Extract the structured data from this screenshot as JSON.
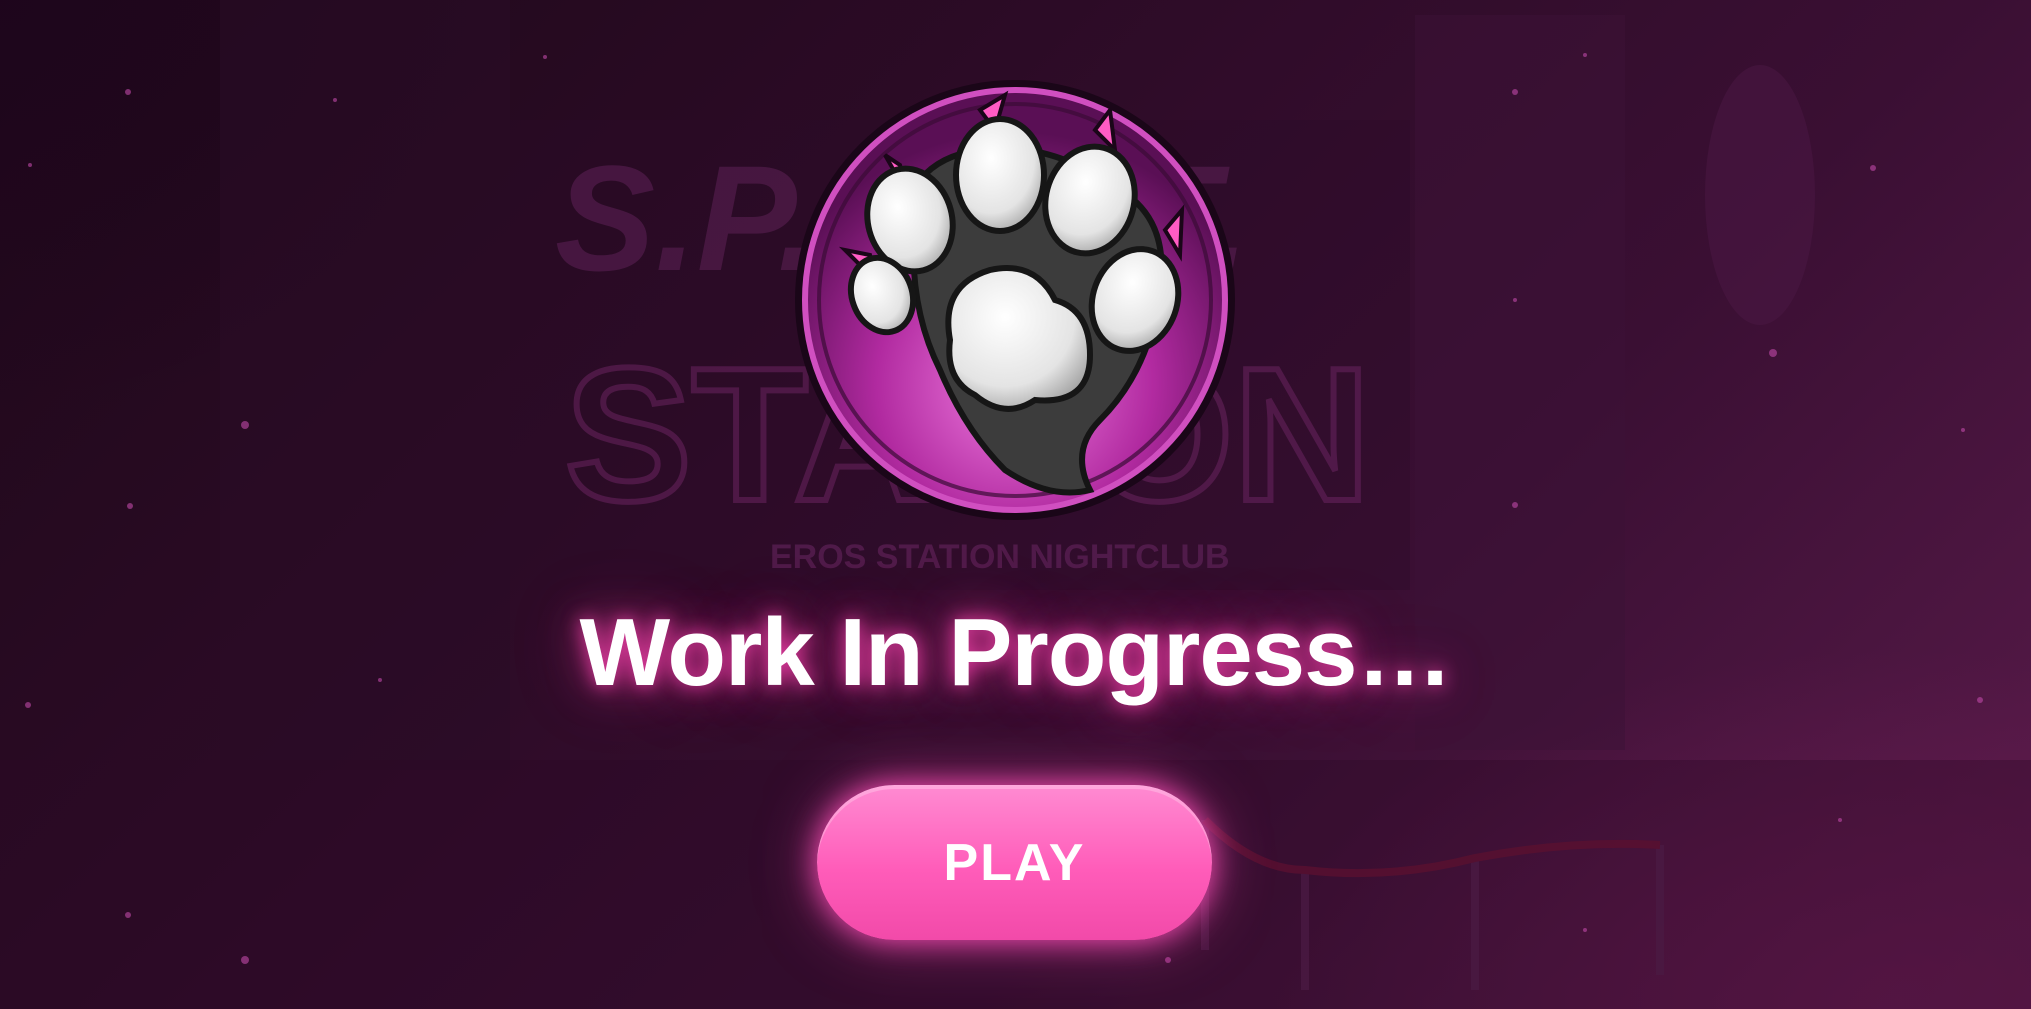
{
  "background": {
    "sign_top": "S.P.O.R.T.",
    "sign_main": "STATION",
    "sign_sub": "EROS STATION NIGHTCLUB"
  },
  "logo": {
    "icon": "paw-icon"
  },
  "title": "Work In Progress…",
  "play_button": {
    "label": "PLAY"
  },
  "colors": {
    "accent": "#ff5cb9",
    "glow": "#ff46b4",
    "bg_dark": "#1e0819",
    "bg_light": "#5a1b4b"
  }
}
